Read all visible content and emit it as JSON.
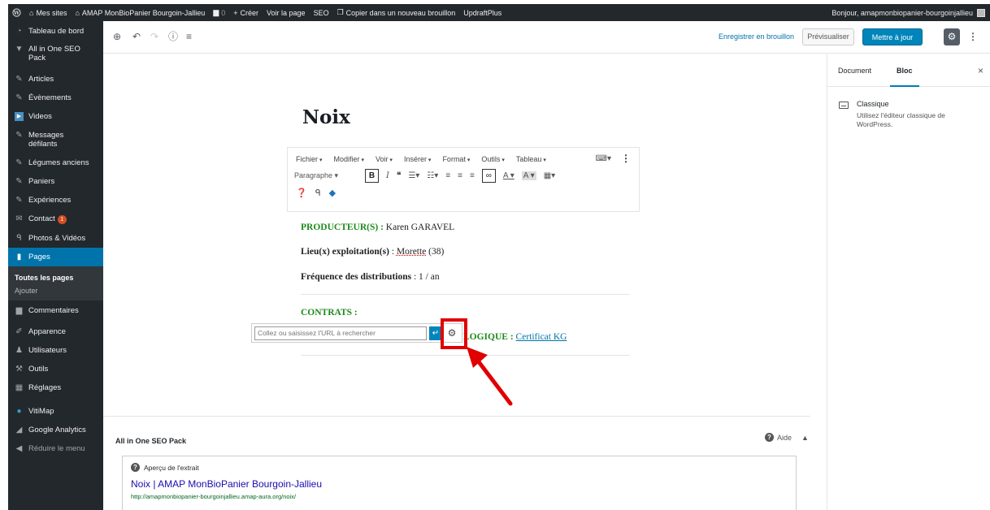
{
  "adminbar": {
    "my_sites": "Mes sites",
    "site_name": "AMAP MonBioPanier Bourgoin-Jallieu",
    "comments_count": "0",
    "create": "Créer",
    "view_page": "Voir la page",
    "seo": "SEO",
    "copy_draft": "Copier dans un nouveau brouillon",
    "updraft": "UpdraftPlus",
    "greeting": "Bonjour, amapmonbiopanier-bourgoinjallieu"
  },
  "sidebar": {
    "dashboard": "Tableau de bord",
    "aioseo": "All in One SEO Pack",
    "articles": "Articles",
    "events": "Évènements",
    "videos": "Videos",
    "messages": "Messages défilants",
    "vegetables": "Légumes anciens",
    "baskets": "Paniers",
    "experiences": "Expériences",
    "contact": "Contact",
    "contact_badge": "1",
    "photos": "Photos & Vidéos",
    "pages": "Pages",
    "all_pages": "Toutes les pages",
    "add": "Ajouter",
    "comments": "Commentaires",
    "appearance": "Apparence",
    "users": "Utilisateurs",
    "tools": "Outils",
    "settings": "Réglages",
    "vitimap": "VitiMap",
    "analytics": "Google Analytics",
    "collapse": "Réduire le menu"
  },
  "toolbar": {
    "save_draft": "Enregistrer en brouillon",
    "preview": "Prévisualiser",
    "update": "Mettre à jour"
  },
  "panel": {
    "tab_document": "Document",
    "tab_block": "Bloc",
    "block_name": "Classique",
    "block_desc": "Utilisez l'éditeur classique de WordPress."
  },
  "editor": {
    "title": "Noix",
    "menu": [
      "Fichier",
      "Modifier",
      "Voir",
      "Insérer",
      "Format",
      "Outils",
      "Tableau"
    ],
    "format": "Paragraphe",
    "producer_label": "PRODUCTEUR(S) :",
    "producer_value": " Karen GARAVEL",
    "place_label": "Lieu(x) exploitation(s)",
    "place_sep": " : ",
    "place_value": "Morette",
    "place_suffix": " (38)",
    "freq_label": "Fréquence des distributions",
    "freq_value": " : 1 / an",
    "contracts_label": "CONTRATS :",
    "organic_label": "LOGIQUE : ",
    "organic_link": "Certificat KG",
    "link_placeholder": "Collez ou saisissez l'URL à rechercher"
  },
  "seo_box": {
    "title": "All in One SEO Pack",
    "help": "Aide",
    "preview_label": "Aperçu de l'extrait",
    "snippet_title": "Noix | AMAP MonBioPanier Bourgoin-Jallieu",
    "snippet_url": "http://amapmonbiopanier-bourgoinjallieu.amap-aura.org/noix/"
  },
  "colors": {
    "admin_dark": "#23282d",
    "primary": "#0085ba",
    "active_menu": "#0073aa",
    "highlight": "#e00000",
    "green_text": "#1d8a1d"
  }
}
